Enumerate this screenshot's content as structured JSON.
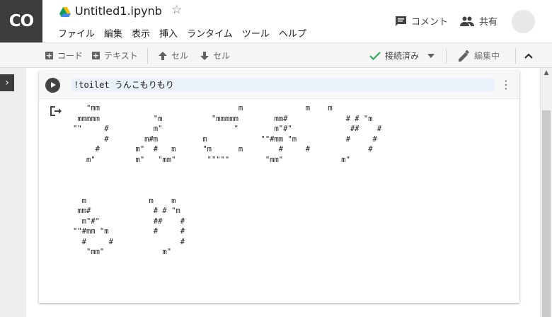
{
  "app": {
    "logo": "CO"
  },
  "doc": {
    "title": "Untitled1.ipynb"
  },
  "menu": [
    "ファイル",
    "編集",
    "表示",
    "挿入",
    "ランタイム",
    "ツール",
    "ヘルプ"
  ],
  "header_actions": {
    "comment": "コメント",
    "share": "共有"
  },
  "toolbar": {
    "add_code": "コード",
    "add_text": "テキスト",
    "cell_up": "セル",
    "cell_down": "セル",
    "status": "接続済み",
    "edit_mode": "編集中"
  },
  "cell": {
    "code": "!toilet うんこもりもり",
    "output": "   \"mm                               m              m    m\n mmmmm            \"m           \"mmmmm        mm#             # # \"m\n\"\"     #          m\"                \"        m\"#\"             ##    #\n       #        m#m          m            \"\"#mm \"m           #     #\n     #        m\"  #   m      \"m      m        #     #             #\n   m\"         m\"   \"mm\"       \"\"\"\"\"        \"mm\"             m\"\n\n\n\n  m              m    m\n mm#              # # \"m\n  m\"#\"            ##    #\n\"\"#mm \"m          #     #\n  #     #               #\n   \"mm\"             m\""
  },
  "colors": {
    "logo_bg": "#3c3c3c",
    "toolbar_bg": "#f5f5f5",
    "status_check": "#34a853",
    "code_line_bg": "#eaf1fb"
  },
  "icons": {
    "drive": "google-drive-icon",
    "star": "star-outline-icon",
    "comment": "comment-icon",
    "share": "people-icon",
    "run": "play-icon",
    "output": "output-arrow-icon"
  }
}
